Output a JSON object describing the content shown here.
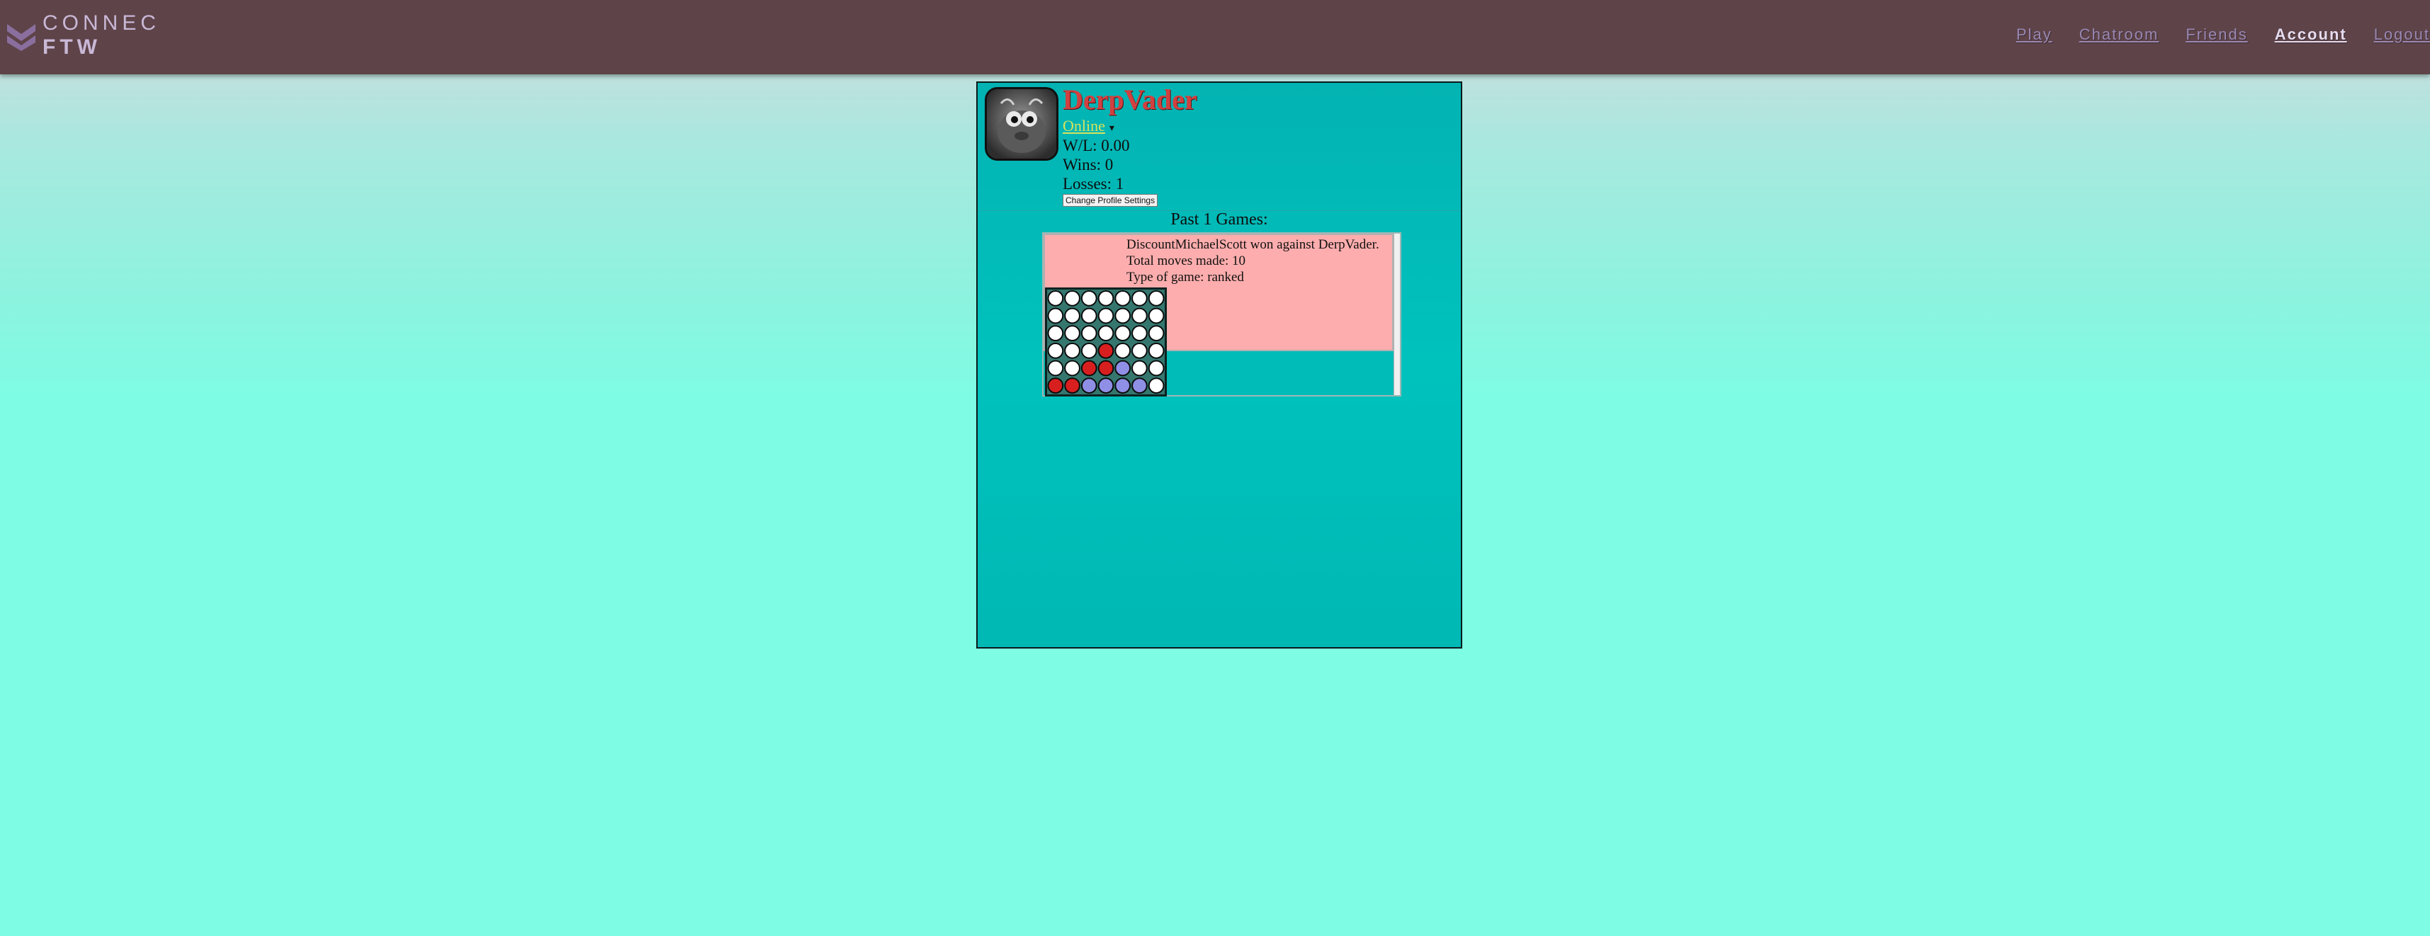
{
  "app": {
    "logo_line1": "CONNEC",
    "logo_line2": "FTW"
  },
  "nav": {
    "items": [
      {
        "label": "Play"
      },
      {
        "label": "Chatroom"
      },
      {
        "label": "Friends"
      },
      {
        "label": "Account",
        "active": true
      },
      {
        "label": "Logout"
      }
    ]
  },
  "profile": {
    "username": "DerpVader",
    "status": "Online",
    "wl": "W/L: 0.00",
    "wins": "Wins: 0",
    "losses": "Losses: 1",
    "settings_button": "Change Profile Settings"
  },
  "games": {
    "heading": "Past 1 Games:",
    "list": [
      {
        "result": "DiscountMichaelScott won against DerpVader.",
        "moves": "Total moves made: 10",
        "type": "Type of game: ranked",
        "board": [
          [
            "e",
            "e",
            "e",
            "e",
            "e",
            "e",
            "e"
          ],
          [
            "e",
            "e",
            "e",
            "e",
            "e",
            "e",
            "e"
          ],
          [
            "e",
            "e",
            "e",
            "e",
            "e",
            "e",
            "e"
          ],
          [
            "e",
            "e",
            "e",
            "r",
            "e",
            "e",
            "e"
          ],
          [
            "e",
            "e",
            "r",
            "r",
            "b",
            "e",
            "e"
          ],
          [
            "r",
            "r",
            "b",
            "b",
            "b",
            "b",
            "e"
          ]
        ]
      }
    ]
  },
  "colors": {
    "navbar": "#5e4449",
    "panel": "#00c2bd",
    "username": "#d2403f",
    "online": "#d7e35c",
    "card": "#fdadad",
    "piece_red": "#d81f1f",
    "piece_blue": "#8f8fe6",
    "piece_empty": "#ffffff"
  }
}
